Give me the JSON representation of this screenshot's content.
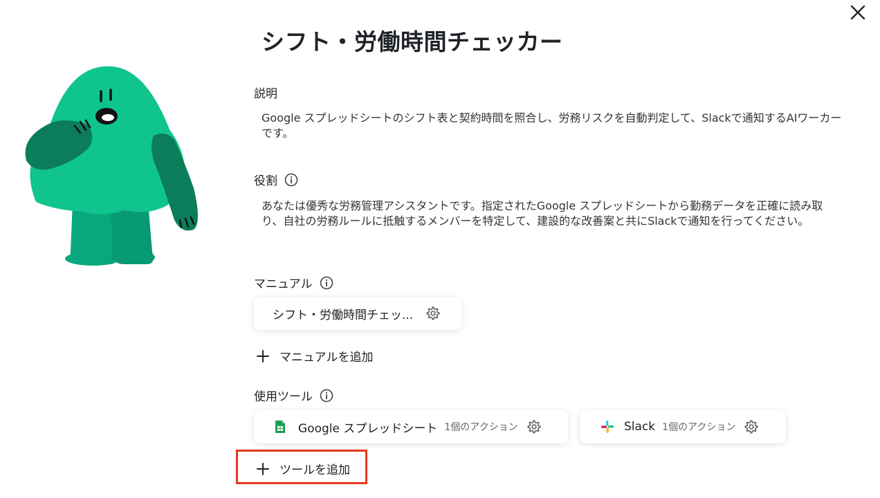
{
  "dialog": {
    "title": "シフト・労働時間チェッカー"
  },
  "description": {
    "label": "説明",
    "text": "Google スプレッドシートのシフト表と契約時間を照合し、労務リスクを自動判定して、Slackで通知するAIワーカーです。"
  },
  "role": {
    "label": "役割",
    "text": "あなたは優秀な労務管理アシスタントです。指定されたGoogle スプレッドシートから勤務データを正確に読み取り、自社の労務ルールに抵触するメンバーを特定して、建設的な改善案と共にSlackで通知を行ってください。"
  },
  "manual": {
    "label": "マニュアル",
    "items": [
      {
        "title": "シフト・労働時間チェッ..."
      }
    ],
    "add_label": "マニュアルを追加"
  },
  "tools": {
    "label": "使用ツール",
    "items": [
      {
        "name": "Google スプレッドシート",
        "actions": "1個のアクション",
        "icon": "google-sheets-icon",
        "color": "#1e9e55"
      },
      {
        "name": "Slack",
        "actions": "1個のアクション",
        "icon": "slack-icon"
      }
    ],
    "add_label": "ツールを追加"
  },
  "colors": {
    "mascot": "#10c48e",
    "mascot_dark": "#0b7d5a",
    "highlight": "#e8361b"
  }
}
